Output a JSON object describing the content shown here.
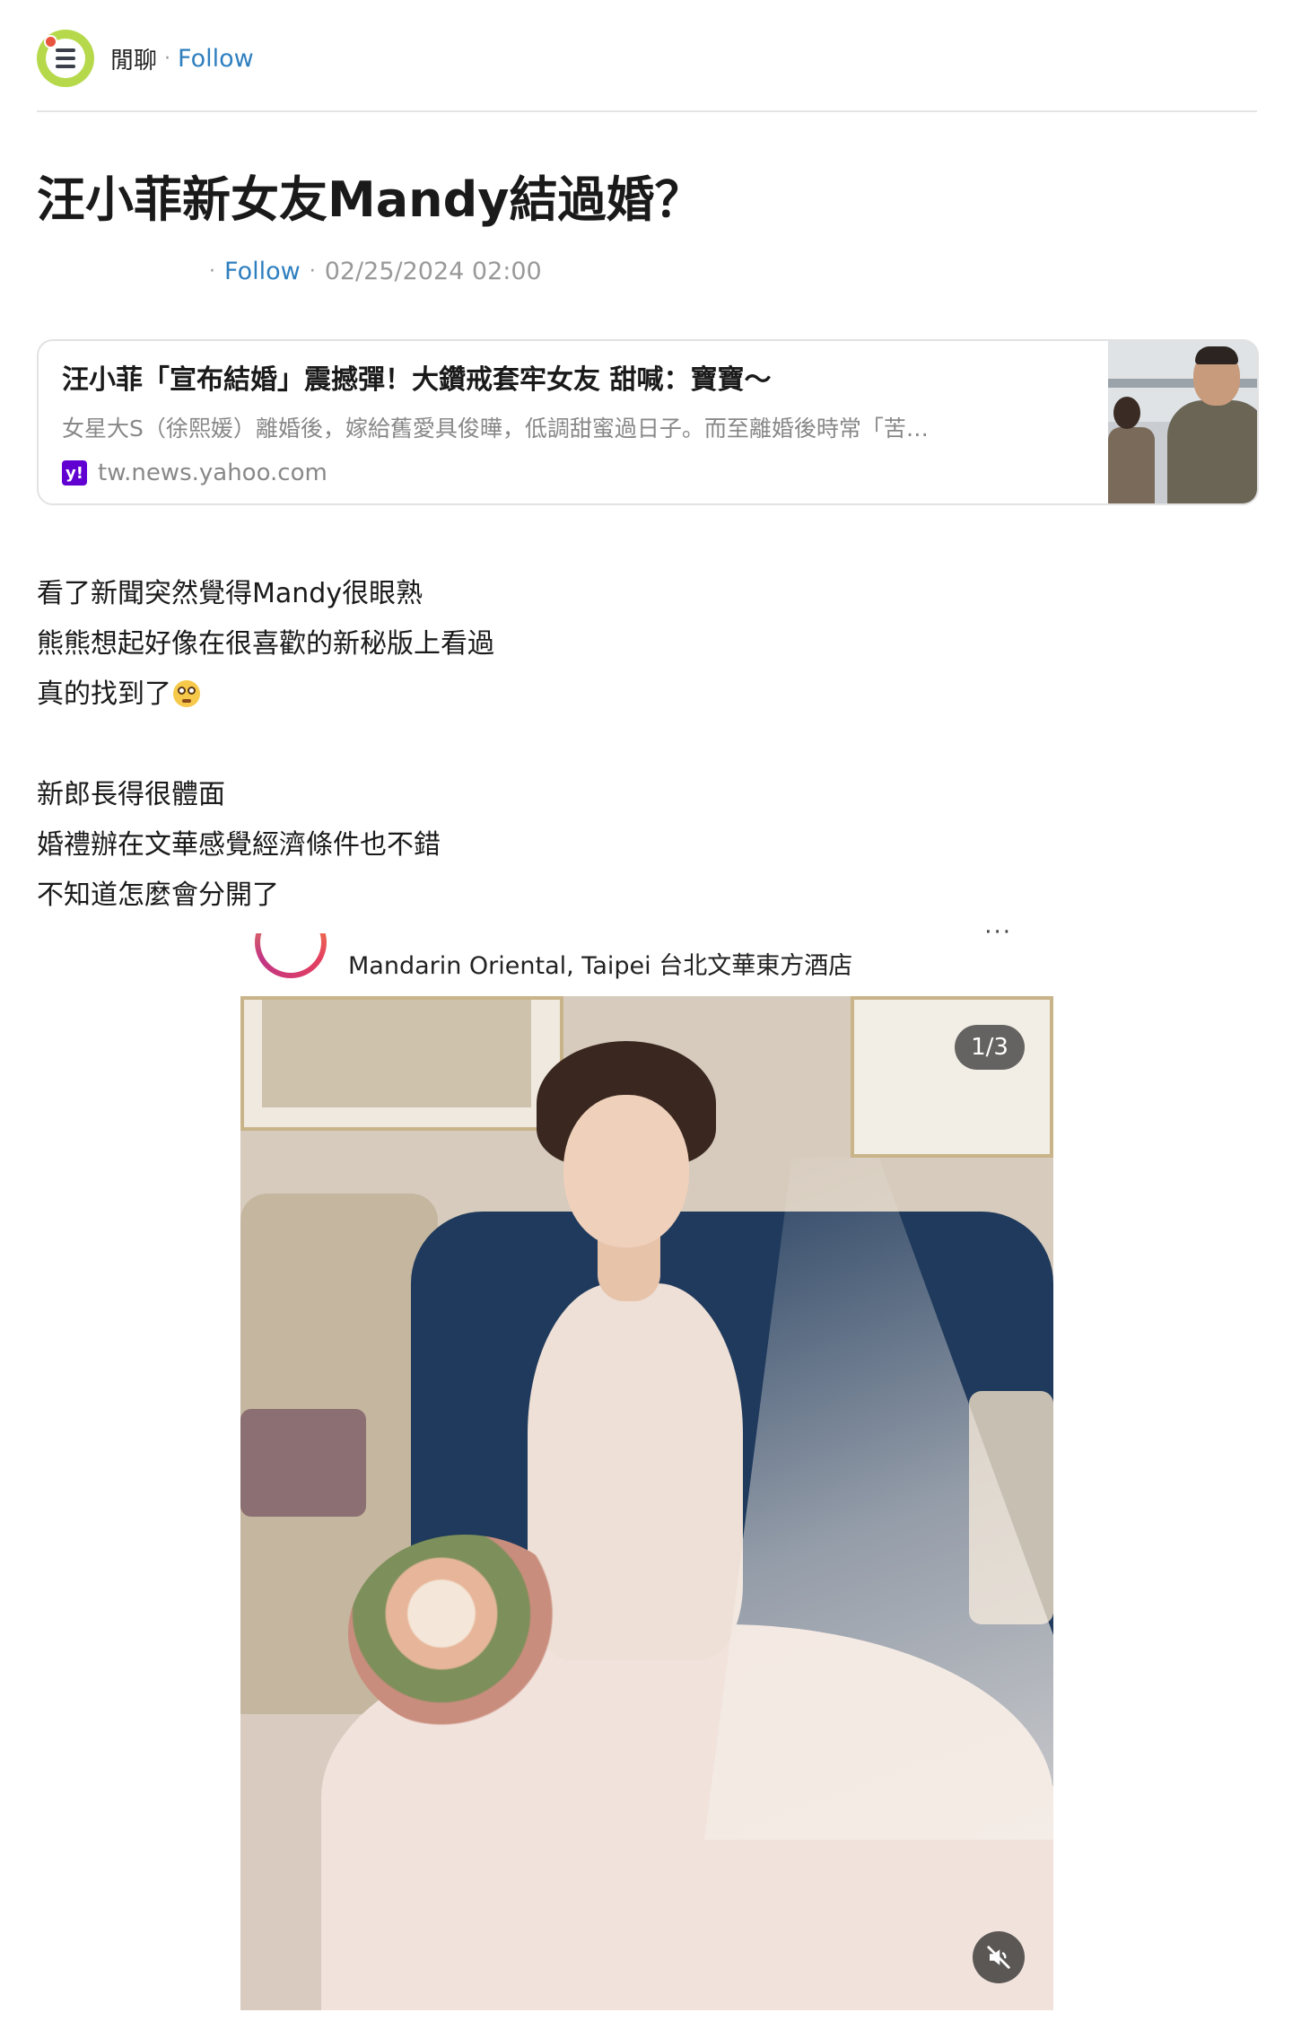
{
  "header": {
    "board_name": "閒聊",
    "separator": "·",
    "follow_label": "Follow"
  },
  "post": {
    "title": "汪小菲新女友Mandy結過婚？",
    "meta": {
      "follow_label": "Follow",
      "date": "02/25/2024 02:00"
    },
    "link_card": {
      "title": "汪小菲「宣布結婚」震撼彈！大鑽戒套牢女友 甜喊：寶寶～",
      "description": "女星大S（徐熙媛）離婚後，嫁給舊愛具俊曄，低調甜蜜過日子。而至離婚後時常「苦…",
      "source": "tw.news.yahoo.com",
      "source_icon_label": "y!"
    },
    "body_lines": [
      "看了新聞突然覺得Mandy很眼熟",
      "熊熊想起好像在很喜歡的新秘版上看過",
      "真的找到了",
      "",
      "新郎長得很體面",
      "婚禮辦在文華感覺經濟條件也不錯",
      "不知道怎麼會分開了"
    ]
  },
  "embed": {
    "location": "Mandarin Oriental, Taipei 台北文華東方酒店",
    "more_label": "···",
    "counter": "1/3"
  },
  "icons": {
    "board": "chat-list-icon",
    "emoji": "flushed-face-icon",
    "source": "yahoo-icon",
    "mute": "speaker-muted-icon"
  },
  "colors": {
    "accent": "#2f7fbf",
    "board_icon": "#b6d94c",
    "yahoo": "#6001d2"
  }
}
